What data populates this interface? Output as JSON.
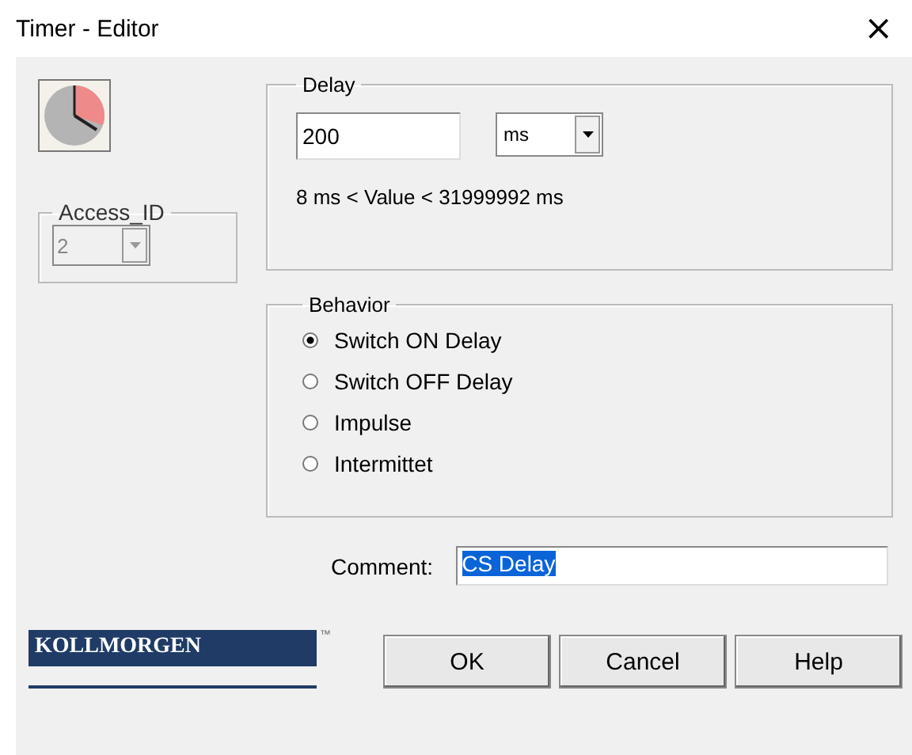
{
  "window": {
    "title": "Timer - Editor",
    "close": "×"
  },
  "access_id": {
    "label": "Access_ID",
    "value": "2",
    "disabled": true
  },
  "delay": {
    "label": "Delay",
    "value": "200",
    "unit": "ms",
    "range": "8 ms < Value < 31999992 ms"
  },
  "behavior": {
    "label": "Behavior",
    "options": [
      {
        "label": "Switch ON Delay",
        "selected": true
      },
      {
        "label": "Switch OFF Delay",
        "selected": false
      },
      {
        "label": "Impulse",
        "selected": false
      },
      {
        "label": "Intermittet",
        "selected": false
      }
    ]
  },
  "comment": {
    "label": "Comment:",
    "value": "CS Delay",
    "selected": true
  },
  "logo": {
    "text": "KOLLMORGEN",
    "mark": "™"
  },
  "buttons": [
    "OK",
    "Cancel",
    "Help"
  ]
}
